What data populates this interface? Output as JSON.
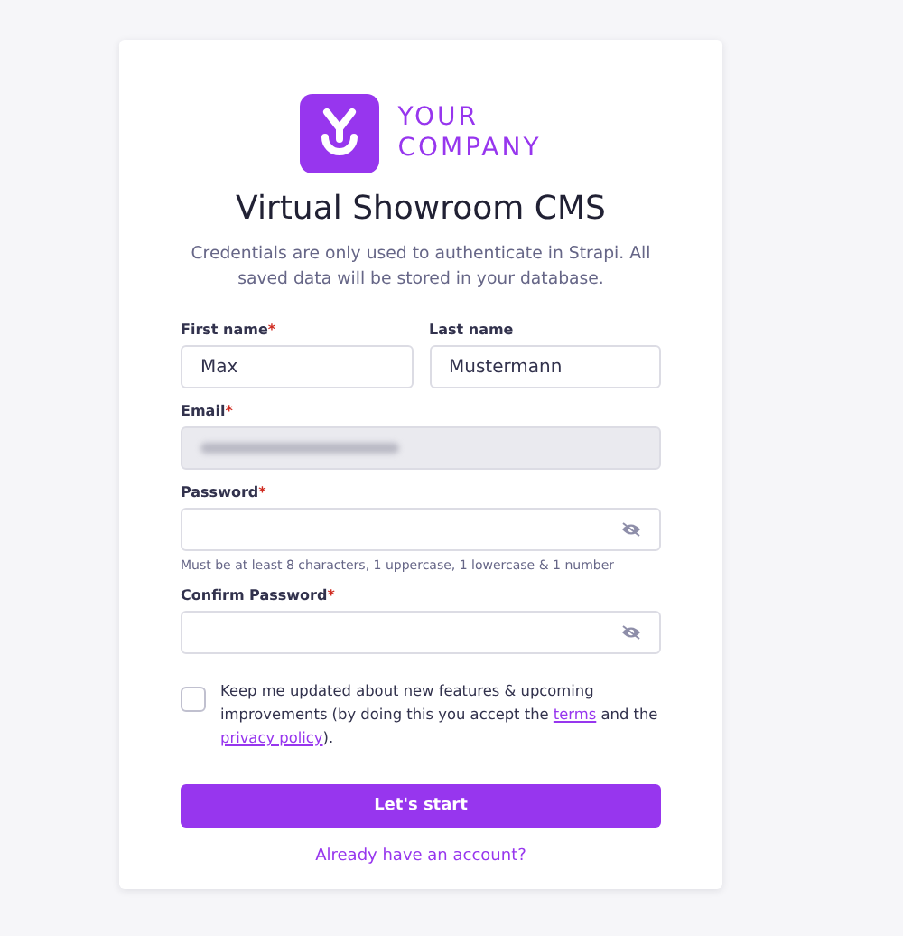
{
  "logo": {
    "line1": "YOUR",
    "line2": "COMPANY"
  },
  "title": "Virtual Showroom CMS",
  "subtitle": "Credentials are only used to authenticate in Strapi. All saved data will be stored in your database.",
  "name_fields": [
    {
      "label": "First name",
      "marker": "*",
      "value": "Max"
    },
    {
      "label": "Last name",
      "value": "Mustermann"
    }
  ],
  "fields": [
    {
      "kind": "redacted",
      "label": "Email",
      "marker": "*",
      "disabled": true
    },
    {
      "kind": "password",
      "label": "Password",
      "marker": "*",
      "disabled": false,
      "hint": "Must be at least 8 characters, 1 uppercase, 1 lowercase & 1 number"
    },
    {
      "kind": "password",
      "label": "Confirm Password",
      "marker": "*",
      "disabled": false
    }
  ],
  "consent": {
    "checked": false,
    "before": "Keep me updated about new features & upcoming improvements (by doing this you accept the",
    "terms": "terms",
    "middle": "and the",
    "privacy": "privacy policy",
    "after": ")."
  },
  "submit": "Let's start",
  "login_link": "Already have an account?"
}
